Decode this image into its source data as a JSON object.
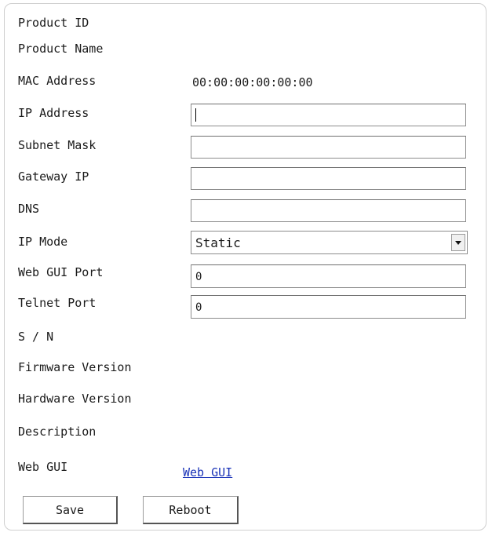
{
  "form": {
    "product_id": {
      "label": "Product ID"
    },
    "product_name": {
      "label": "Product Name"
    },
    "mac_address": {
      "label": "MAC Address",
      "value": "00:00:00:00:00:00"
    },
    "ip_address": {
      "label": "IP Address",
      "value": ""
    },
    "subnet_mask": {
      "label": "Subnet Mask",
      "value": ""
    },
    "gateway_ip": {
      "label": "Gateway IP",
      "value": ""
    },
    "dns": {
      "label": "DNS",
      "value": ""
    },
    "ip_mode": {
      "label": "IP Mode",
      "selected": "Static"
    },
    "web_gui_port": {
      "label": "Web GUI Port",
      "value": "0"
    },
    "telnet_port": {
      "label": "Telnet Port",
      "value": "0"
    },
    "serial_number": {
      "label": "S / N"
    },
    "firmware_version": {
      "label": "Firmware Version"
    },
    "hardware_version": {
      "label": "Hardware Version"
    },
    "description": {
      "label": "Description"
    },
    "web_gui": {
      "label": "Web GUI",
      "link_text": "Web GUI"
    }
  },
  "buttons": {
    "save": "Save",
    "reboot": "Reboot"
  },
  "colors": {
    "link": "#1a33b8",
    "border": "#8c8c8c"
  }
}
